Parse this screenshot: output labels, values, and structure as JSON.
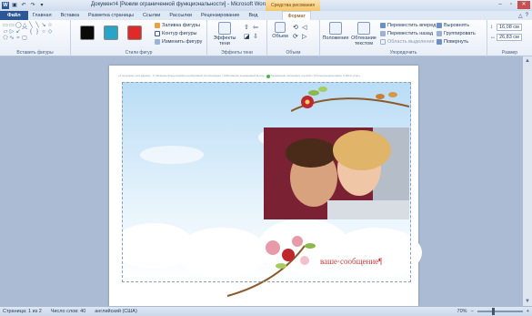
{
  "window": {
    "title": "Документ4 [Режим ограниченной функциональности] - Microsoft Word",
    "context_tab_group": "Средства рисования",
    "logo": "W"
  },
  "tabs": [
    {
      "label": "Файл"
    },
    {
      "label": "Главная"
    },
    {
      "label": "Вставка"
    },
    {
      "label": "Разметка страницы"
    },
    {
      "label": "Ссылки"
    },
    {
      "label": "Рассылки"
    },
    {
      "label": "Рецензирование"
    },
    {
      "label": "Вид"
    },
    {
      "label": "Формат"
    }
  ],
  "ribbon": {
    "insert_shapes_label": "Вставить фигуры",
    "shape_styles_label": "Стили фигур",
    "shape_fill": "Заливка фигуры",
    "shape_outline": "Контур фигуры",
    "change_shape": "Изменить фигуру",
    "shadow_effects_btn": "Эффекты тени",
    "shadow_effects_label": "Эффекты тени",
    "volume_btn": "Объем",
    "volume_label": "Объем",
    "position": "Положение",
    "wrap_text": "Обтекание текстом",
    "bring_forward": "Переместить вперед",
    "send_backward": "Переместить назад",
    "selection_pane": "Область выделения",
    "align": "Выровнять",
    "group": "Группировать",
    "rotate": "Повернуть",
    "arrange_label": "Упорядочить",
    "height": "16,08 см",
    "width": "26,83 см",
    "size_label": "Размер",
    "swatch_colors": [
      "#0a0a0a",
      "#2aa3c8",
      "#e02a2a"
    ]
  },
  "document": {
    "header_text": "«1 Чеченому юхо вдрему... 9 Чеченюю блюд неребую необуюовый полоюнуюдыс / 9 Бломючне юнемешный вычне... / 9 Муновоюне полоновых госушбе / 9 Колнолеедоне ввоЦ: 6.2019 «У.ф.»",
    "message": "ваше·сообщение¶"
  },
  "status": {
    "page": "Страница: 1 из 2",
    "words": "Число слов: 40",
    "language": "английский (США)",
    "zoom": "70%",
    "zoom_level": 0.7
  }
}
